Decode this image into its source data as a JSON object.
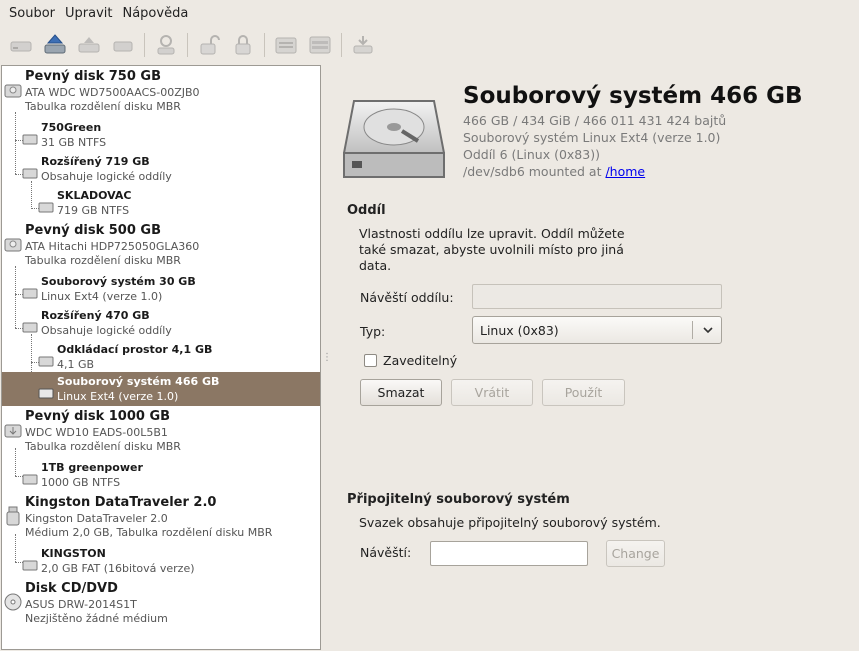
{
  "menu": [
    "Soubor",
    "Upravit",
    "Nápověda"
  ],
  "tree": [
    {
      "type": "drive",
      "title": "Pevný disk 750 GB",
      "sub1": "ATA WDC WD7500AACS-00ZJB0",
      "sub2": "Tabulka rozdělení disku MBR"
    },
    {
      "type": "part",
      "title": "750Green",
      "sub1": "31 GB NTFS"
    },
    {
      "type": "part",
      "title": "Rozšířený 719 GB",
      "sub1": "Obsahuje logické oddíly"
    },
    {
      "type": "part",
      "title": "SKLADOVAC",
      "sub1": "719 GB NTFS"
    },
    {
      "type": "drive",
      "title": "Pevný disk 500 GB",
      "sub1": "ATA Hitachi HDP725050GLA360",
      "sub2": "Tabulka rozdělení disku MBR"
    },
    {
      "type": "part",
      "title": "Souborový systém 30 GB",
      "sub1": "Linux Ext4 (verze 1.0)"
    },
    {
      "type": "part",
      "title": "Rozšířený 470 GB",
      "sub1": "Obsahuje logické oddíly"
    },
    {
      "type": "part",
      "title": "Odkládací prostor 4,1 GB",
      "sub1": "4,1 GB"
    },
    {
      "type": "part",
      "title": "Souborový systém 466 GB",
      "sub1": "Linux Ext4 (verze 1.0)",
      "selected": true
    },
    {
      "type": "drive",
      "title": "Pevný disk 1000 GB",
      "sub1": "WDC WD10 EADS-00L5B1",
      "sub2": "Tabulka rozdělení disku MBR"
    },
    {
      "type": "part",
      "title": "1TB greenpower",
      "sub1": "1000 GB NTFS"
    },
    {
      "type": "drive",
      "title": "Kingston DataTraveler 2.0",
      "sub1": "Kingston DataTraveler 2.0",
      "sub2": "Médium 2,0 GB, Tabulka rozdělení disku MBR"
    },
    {
      "type": "part",
      "title": "KINGSTON",
      "sub1": "2,0 GB FAT (16bitová verze)"
    },
    {
      "type": "drive",
      "title": "Disk CD/DVD",
      "sub1": "ASUS DRW-2014S1T",
      "sub2": "Nezjištěno žádné médium"
    }
  ],
  "volume": {
    "title": "Souborový systém 466 GB",
    "size_line": "466 GB / 434 GiB / 466 011 431 424 bajtů",
    "fs_line": "Souborový systém Linux Ext4 (verze 1.0)",
    "partition_line": "Oddíl 6 (Linux (0x83))",
    "mount_prefix": "/dev/sdb6 mounted at ",
    "mount_link": "/home"
  },
  "partition_section": {
    "title": "Oddíl",
    "desc_1": "Vlastnosti oddílu lze upravit. Oddíl můžete",
    "desc_2": "také smazat, abyste uvolnili místo pro jiná",
    "desc_3": "data.",
    "label_label": "Návěští oddílu:",
    "label_value": "",
    "type_label": "Typ:",
    "type_value": "Linux (0x83)",
    "bootable_label": "Zaveditelný",
    "bootable_checked": false,
    "delete_button": "Smazat",
    "revert_button": "Vrátit",
    "apply_button": "Použít"
  },
  "fs_section": {
    "title": "Připojitelný souborový systém",
    "desc": "Svazek obsahuje připojitelný souborový systém.",
    "label_label": "Návěští:",
    "label_value": "",
    "change_button": "Change"
  }
}
